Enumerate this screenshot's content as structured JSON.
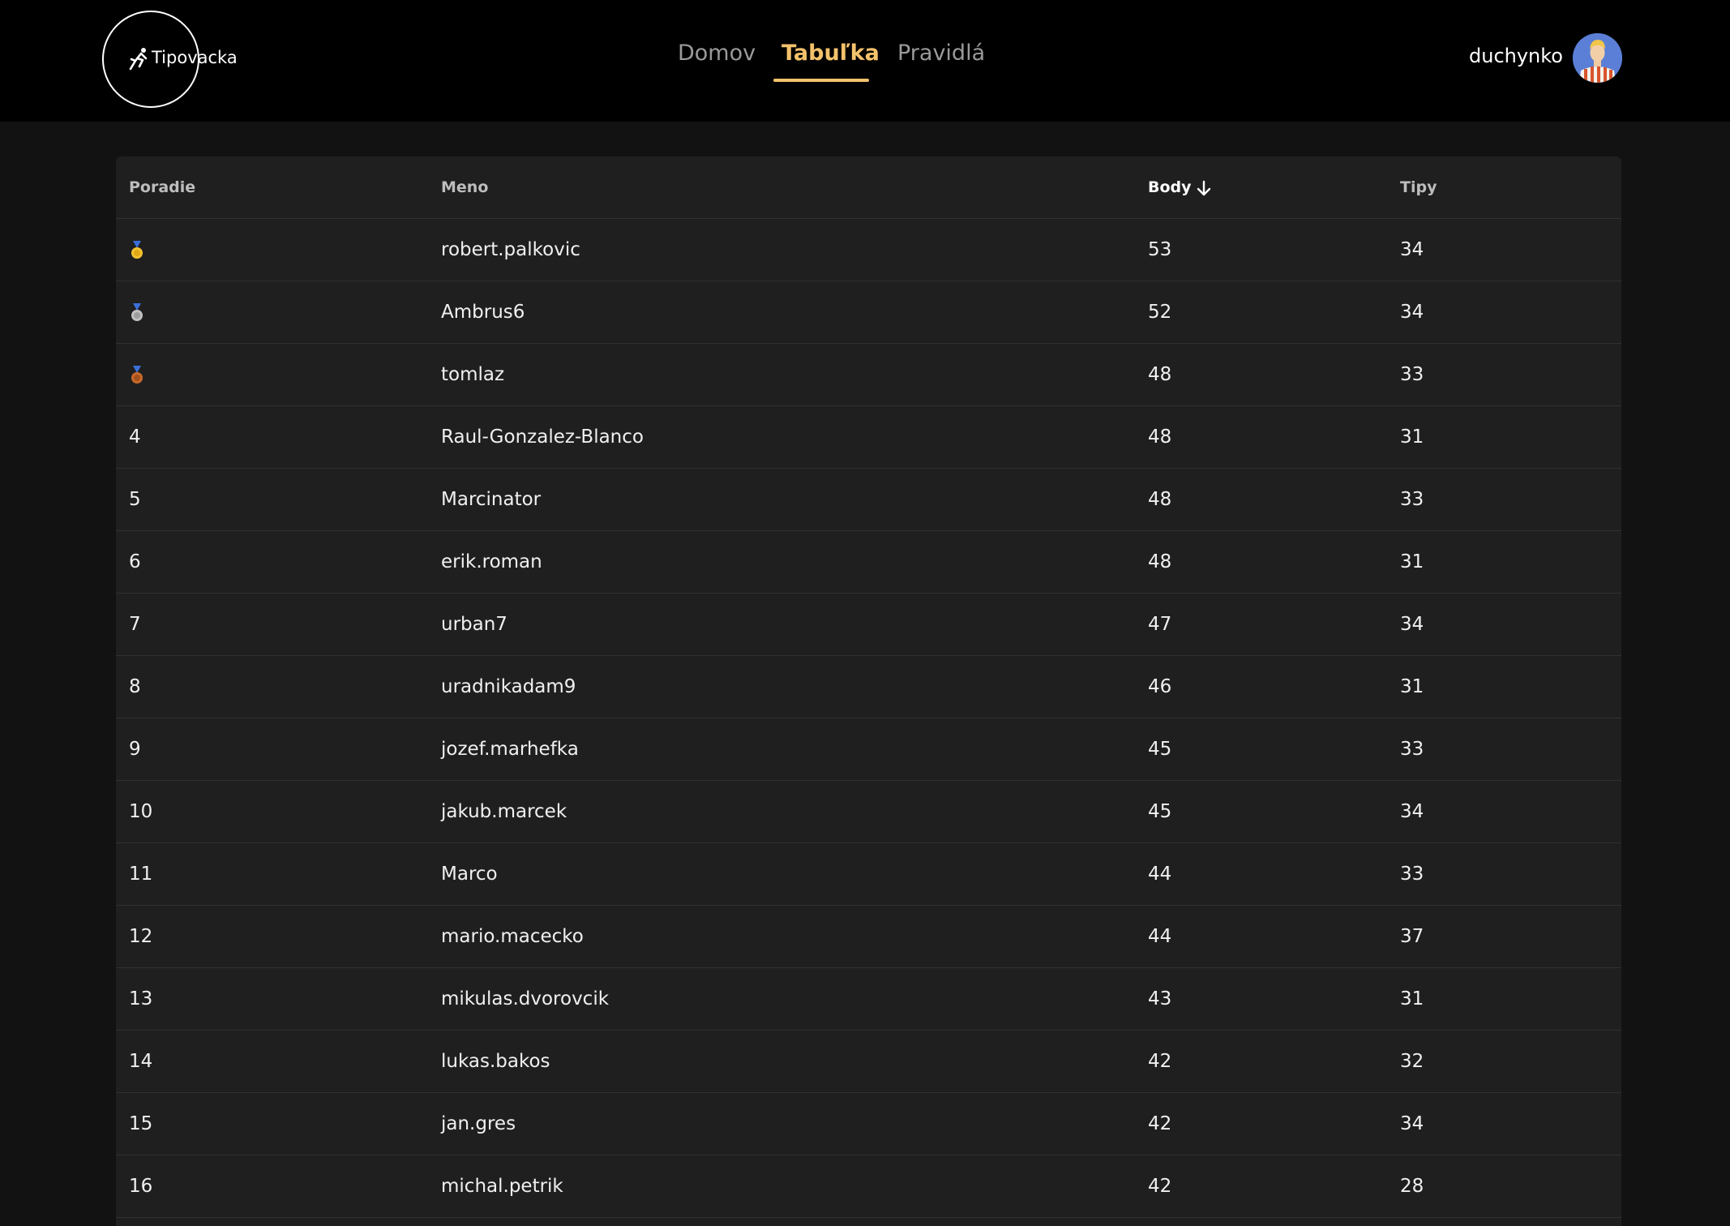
{
  "header": {
    "logo_text": "Tipovacka",
    "nav": [
      {
        "label": "Domov",
        "active": false
      },
      {
        "label": "Tabuľka",
        "active": true
      },
      {
        "label": "Pravidlá",
        "active": false
      }
    ],
    "username": "duchynko",
    "avatar_icon": "avatar-person-icon"
  },
  "colors": {
    "accent": "#f3c26b",
    "background": "#121212",
    "topbar": "#000000",
    "table": "#1f1f1f",
    "gold": "#f2c230",
    "silver": "#c0c0c0",
    "bronze": "#c8692c"
  },
  "table": {
    "columns": [
      "Poradie",
      "Meno",
      "Body",
      "Tipy"
    ],
    "sorted_column": "Body",
    "sort_direction": "descending",
    "rows": [
      {
        "rank": "",
        "medal": "gold-medal-icon",
        "name": "robert.palkovic",
        "points": "53",
        "tips": "34"
      },
      {
        "rank": "",
        "medal": "silver-medal-icon",
        "name": "Ambrus6",
        "points": "52",
        "tips": "34"
      },
      {
        "rank": "",
        "medal": "bronze-medal-icon",
        "name": "tomlaz",
        "points": "48",
        "tips": "33"
      },
      {
        "rank": "4",
        "name": "Raul-Gonzalez-Blanco",
        "points": "48",
        "tips": "31"
      },
      {
        "rank": "5",
        "name": "Marcinator",
        "points": "48",
        "tips": "33"
      },
      {
        "rank": "6",
        "name": "erik.roman",
        "points": "48",
        "tips": "31"
      },
      {
        "rank": "7",
        "name": "urban7",
        "points": "47",
        "tips": "34"
      },
      {
        "rank": "8",
        "name": "uradnikadam9",
        "points": "46",
        "tips": "31"
      },
      {
        "rank": "9",
        "name": "jozef.marhefka",
        "points": "45",
        "tips": "33"
      },
      {
        "rank": "10",
        "name": "jakub.marcek",
        "points": "45",
        "tips": "34"
      },
      {
        "rank": "11",
        "name": "Marco",
        "points": "44",
        "tips": "33"
      },
      {
        "rank": "12",
        "name": "mario.macecko",
        "points": "44",
        "tips": "37"
      },
      {
        "rank": "13",
        "name": "mikulas.dvorovcik",
        "points": "43",
        "tips": "31"
      },
      {
        "rank": "14",
        "name": "lukas.bakos",
        "points": "42",
        "tips": "32"
      },
      {
        "rank": "15",
        "name": "jan.gres",
        "points": "42",
        "tips": "34"
      },
      {
        "rank": "16",
        "name": "michal.petrik",
        "points": "42",
        "tips": "28"
      }
    ]
  }
}
